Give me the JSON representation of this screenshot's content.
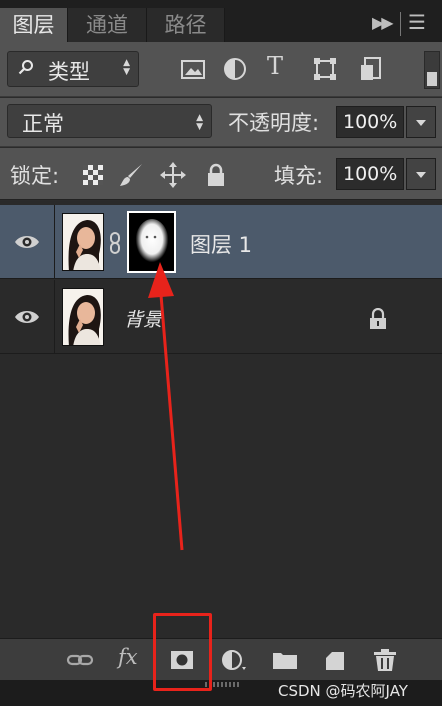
{
  "tabs": [
    {
      "label": "图层",
      "active": true
    },
    {
      "label": "通道",
      "active": false
    },
    {
      "label": "路径",
      "active": false
    }
  ],
  "panel_menu_icon": "panel-menu-icon",
  "filter": {
    "kind_label": "类型",
    "icons": [
      "image-filter-icon",
      "adjustment-filter-icon",
      "type-filter-icon",
      "shape-filter-icon",
      "smart-object-filter-icon"
    ]
  },
  "blend": {
    "mode": "正常",
    "opacity_label": "不透明度:",
    "opacity_value": "100%"
  },
  "lock": {
    "label": "锁定:",
    "icons": [
      "lock-transparent-icon",
      "lock-image-icon",
      "lock-position-icon",
      "lock-all-icon"
    ],
    "fill_label": "填充:",
    "fill_value": "100%"
  },
  "layers": [
    {
      "name": "图层 1",
      "selected": true,
      "has_mask": true
    },
    {
      "name": "背景",
      "selected": false,
      "locked": true
    }
  ],
  "bottom_icons": [
    "link-layers-icon",
    "fx-icon",
    "add-mask-icon",
    "adjustment-layer-icon",
    "new-group-icon",
    "new-layer-icon",
    "delete-icon"
  ],
  "fx_label": "fx",
  "watermark": "CSDN @码农阿JAY",
  "colors": {
    "annotation": "#e8231b",
    "selection": "#4c5a6b",
    "panel": "#535353"
  }
}
